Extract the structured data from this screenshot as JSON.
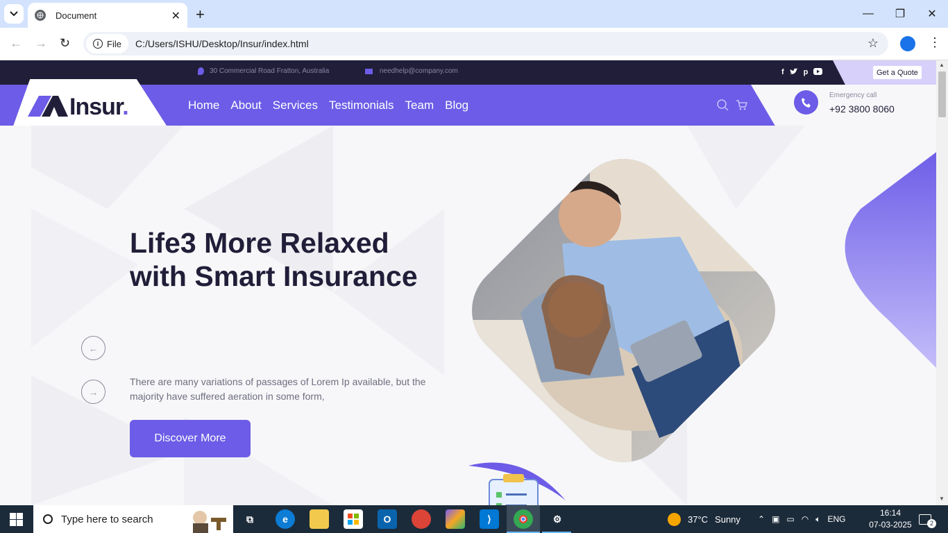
{
  "browser": {
    "tab_title": "Document",
    "new_tab": "+",
    "file_chip": "File",
    "url": "C:/Users/ISHU/Desktop/Insur/index.html"
  },
  "topbar": {
    "address": "30 Commercial Road Fratton, Australia",
    "email": "needhelp@company.com",
    "socials": [
      "f",
      "t",
      "p",
      "y"
    ],
    "quote_button": "Get a Quote"
  },
  "header": {
    "logo_main": "Insur",
    "logo_dot": ".",
    "menu": [
      "Home",
      "About",
      "Services",
      "Testimonials",
      "Team",
      "Blog"
    ],
    "call_label": "Emergency call",
    "call_number": "+92 3800 8060"
  },
  "hero": {
    "title_line1": "Life3 More Relaxed",
    "title_line2": "with Smart Insurance",
    "description": "There are many variations of passages of Lorem Ip available, but the majority have suffered aeration in some form,",
    "cta": "Discover More",
    "prev_arrow": "←",
    "next_arrow": "→"
  },
  "taskbar": {
    "search_placeholder": "Type here to search",
    "weather_temp": "37°C",
    "weather_desc": "Sunny",
    "language": "ENG",
    "time": "16:14",
    "date": "07-03-2025",
    "notification_count": "2"
  },
  "colors": {
    "brand": "#6c5ce7",
    "dark": "#201e38",
    "chrome": "#d3e3fd"
  }
}
